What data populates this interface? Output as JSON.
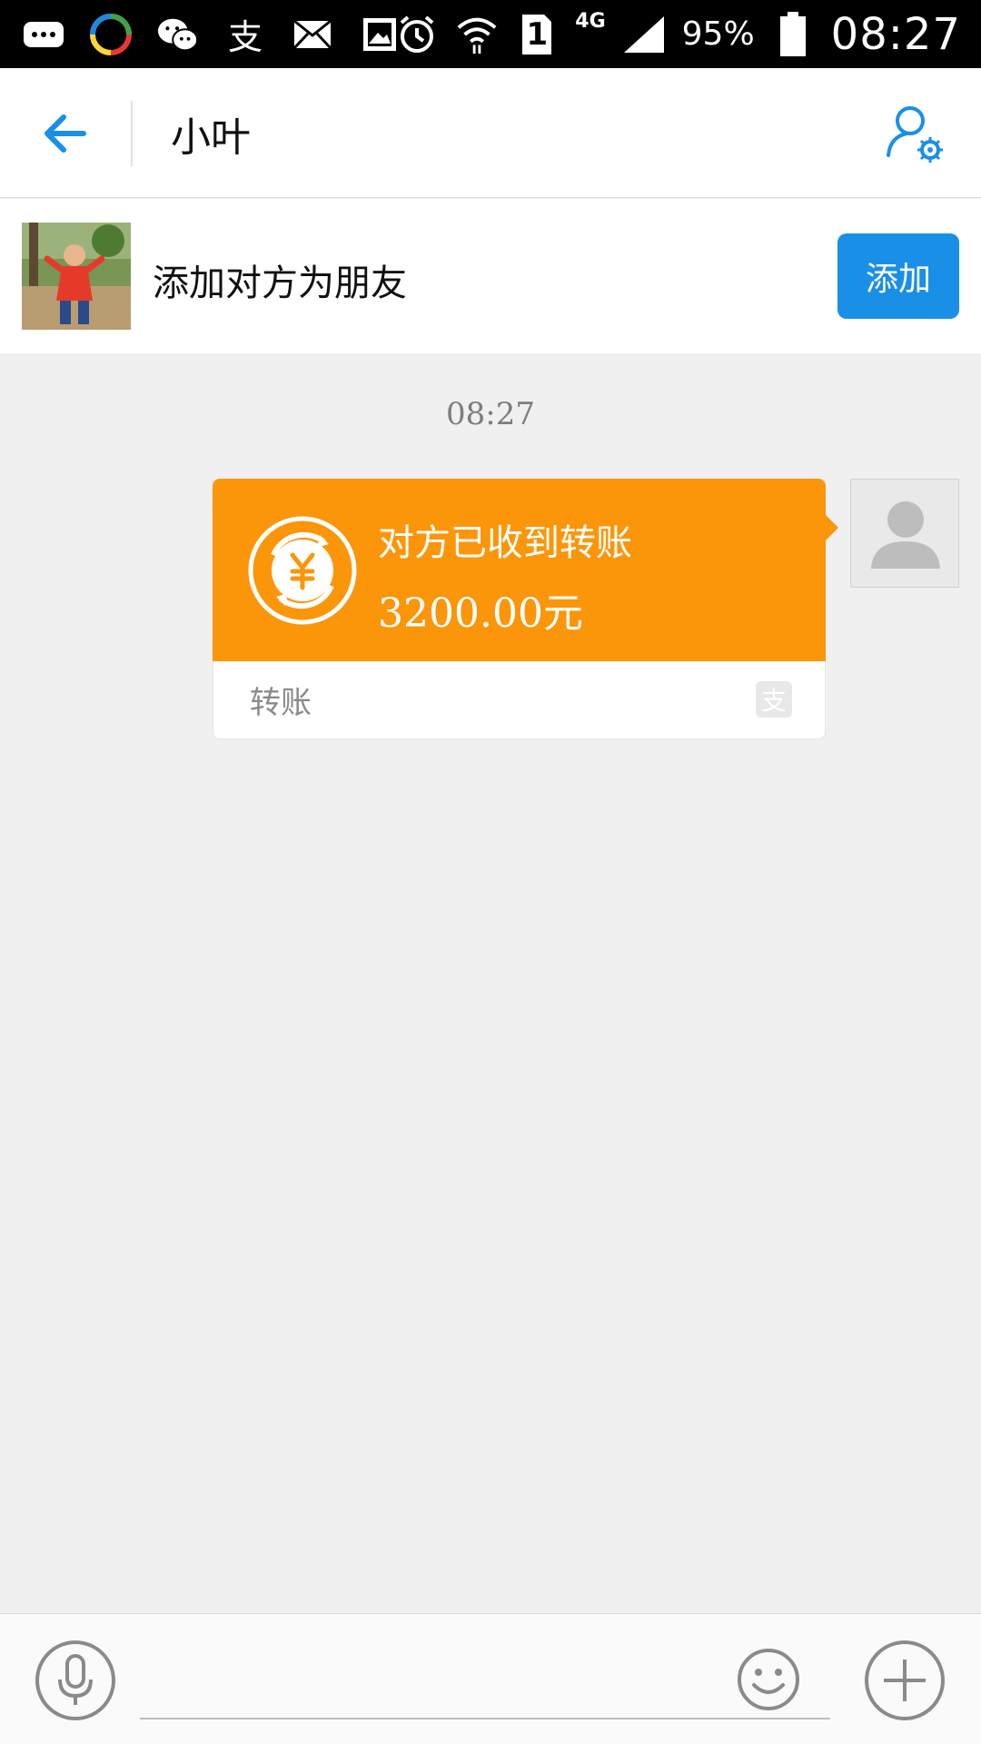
{
  "status_bar": {
    "battery_percent": "95%",
    "network": "4G",
    "sim_slot": "1",
    "time": "08:27",
    "notification_icons": [
      "message-icon",
      "app-icon",
      "wechat-icon",
      "alipay-icon",
      "mail-icon",
      "gallery-icon"
    ],
    "system_icons": [
      "alarm-icon",
      "wifi-icon",
      "sim-icon",
      "signal-icon",
      "battery-icon"
    ]
  },
  "header": {
    "title": "小叶",
    "back_icon": "back-arrow-icon",
    "settings_icon": "profile-settings-icon"
  },
  "add_friend": {
    "text": "添加对方为朋友",
    "button_label": "添加"
  },
  "chat": {
    "timestamp": "08:27",
    "message": {
      "status_text": "对方已收到转账",
      "amount": "3200.00元",
      "type_label": "转账",
      "brand_icon": "支",
      "accent_color": "#fb960a"
    }
  },
  "input_bar": {
    "placeholder": "",
    "voice_icon": "microphone-icon",
    "emoji_icon": "emoji-icon",
    "plus_icon": "plus-icon"
  },
  "colors": {
    "primary_blue": "#1a8fe8",
    "transfer_orange": "#fb960a",
    "background": "#f0f0f0"
  }
}
